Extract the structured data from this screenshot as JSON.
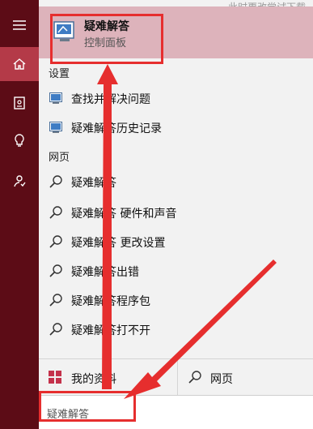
{
  "background_hint": "此时更改尝试下载，问题也将",
  "left_rail": {
    "items": [
      {
        "name": "menu",
        "active": false
      },
      {
        "name": "home",
        "active": true
      },
      {
        "name": "notebook",
        "active": false
      },
      {
        "name": "lightbulb",
        "active": false
      },
      {
        "name": "feedback",
        "active": false
      }
    ]
  },
  "best_match": {
    "title": "疑难解答",
    "subtitle": "控制面板",
    "icon": "troubleshooting-monitor-icon"
  },
  "settings": {
    "header": "设置",
    "items": [
      {
        "label": "查找并解决问题",
        "icon": "settings-monitor-icon"
      },
      {
        "label": "疑难解答历史记录",
        "icon": "settings-monitor-icon"
      }
    ]
  },
  "web": {
    "header": "网页",
    "items": [
      {
        "label": "疑难解答",
        "icon": "search-icon"
      },
      {
        "label": "疑难解答 硬件和声音",
        "icon": "search-icon"
      },
      {
        "label": "疑难解答 更改设置",
        "icon": "search-icon"
      },
      {
        "label": "疑难解答出错",
        "icon": "search-icon"
      },
      {
        "label": "疑难解答程序包",
        "icon": "search-icon"
      },
      {
        "label": "疑难解答打不开",
        "icon": "search-icon"
      }
    ]
  },
  "bottom_bar": {
    "my_stuff_label": "我的资料",
    "web_label": "网页"
  },
  "search": {
    "value": "疑难解答"
  },
  "colors": {
    "rail": "#5c0c16",
    "rail_active": "#b43a48",
    "highlight": "#ddb3bb",
    "annotation": "#e62e2e"
  }
}
